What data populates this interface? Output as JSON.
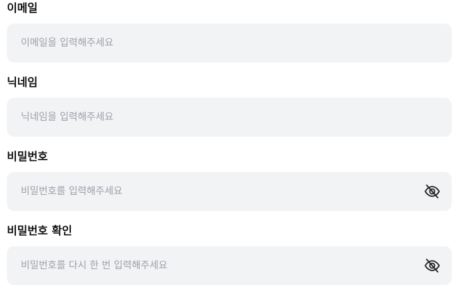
{
  "form": {
    "email": {
      "label": "이메일",
      "placeholder": "이메일을 입력해주세요"
    },
    "nickname": {
      "label": "닉네임",
      "placeholder": "닉네임을 입력해주세요"
    },
    "password": {
      "label": "비밀번호",
      "placeholder": "비밀번호를 입력해주세요",
      "icon": "eye-off-icon"
    },
    "password_confirm": {
      "label": "비밀번호 확인",
      "placeholder": "비밀번호를 다시 한 번 입력해주세요",
      "icon": "eye-off-icon"
    }
  },
  "colors": {
    "input_background": "#f2f3f5",
    "placeholder_text": "#9ca0a8",
    "label_text": "#111111"
  }
}
